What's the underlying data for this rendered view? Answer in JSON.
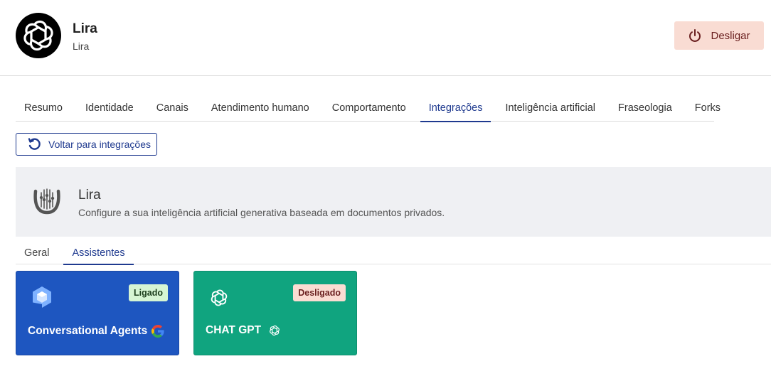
{
  "header": {
    "name": "Lira",
    "subtitle": "Lira",
    "off_button_label": "Desligar"
  },
  "tabs": [
    {
      "label": "Resumo",
      "active": false
    },
    {
      "label": "Identidade",
      "active": false
    },
    {
      "label": "Canais",
      "active": false
    },
    {
      "label": "Atendimento humano",
      "active": false
    },
    {
      "label": "Comportamento",
      "active": false
    },
    {
      "label": "Integrações",
      "active": true
    },
    {
      "label": "Inteligência artificial",
      "active": false
    },
    {
      "label": "Fraseologia",
      "active": false
    },
    {
      "label": "Forks",
      "active": false
    }
  ],
  "back_button_label": "Voltar para integrações",
  "banner": {
    "title": "Lira",
    "description": "Configure a sua inteligência artificial generativa baseada em documentos privados.",
    "icon": "lyre-icon"
  },
  "subtabs": [
    {
      "label": "Geral",
      "active": false
    },
    {
      "label": "Assistentes",
      "active": true
    }
  ],
  "cards": [
    {
      "title": "Conversational Agents",
      "status": "Ligado",
      "icon": "dialogflow-icon",
      "brand_icon": "google-icon",
      "color": "#1e56c0"
    },
    {
      "title": "CHAT GPT",
      "status": "Desligado",
      "icon": "openai-icon",
      "brand_icon": "openai-icon",
      "color": "#10a47f"
    }
  ],
  "colors": {
    "accent": "#1f3a8f",
    "danger_bg": "#f9dcd3",
    "success_bg": "#d6f5d3"
  }
}
